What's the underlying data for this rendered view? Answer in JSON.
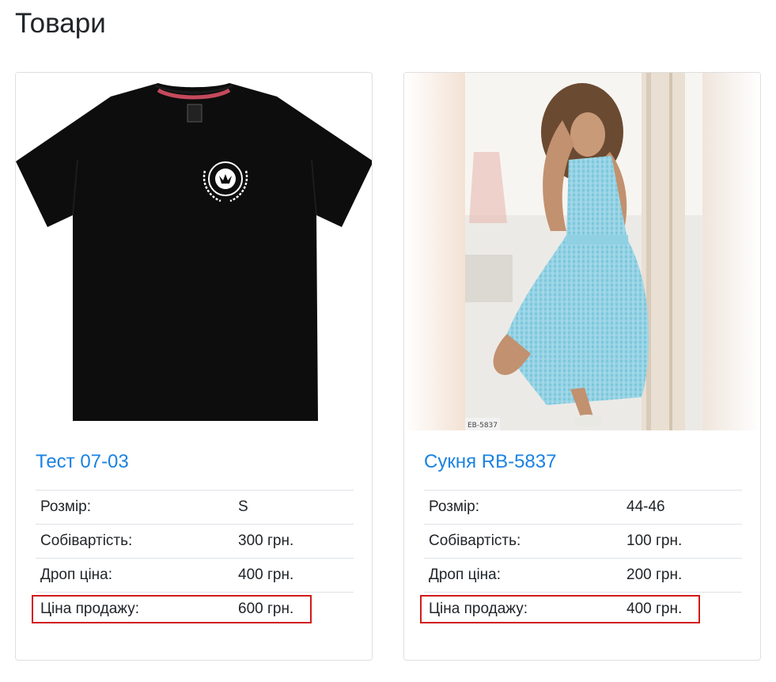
{
  "page": {
    "title": "Товари"
  },
  "products": [
    {
      "title": "Тест 07-03",
      "image": "black-tshirt",
      "rows": [
        {
          "label": "Розмір:",
          "value": "S"
        },
        {
          "label": "Собівартість:",
          "value": "300 грн."
        },
        {
          "label": "Дроп ціна:",
          "value": "400 грн."
        },
        {
          "label": "Ціна продажу:",
          "value": "600 грн."
        }
      ]
    },
    {
      "title": "Сукня RB-5837",
      "image": "blue-gingham-dress-photo",
      "image_watermark": "EB-5837",
      "rows": [
        {
          "label": "Розмір:",
          "value": "44-46"
        },
        {
          "label": "Собівартість:",
          "value": "100 грн."
        },
        {
          "label": "Дроп ціна:",
          "value": "200 грн."
        },
        {
          "label": "Ціна продажу:",
          "value": "400 грн."
        }
      ]
    }
  ],
  "colors": {
    "link": "#1a82e2",
    "highlight_border": "#d21a1a",
    "card_border": "#dfdfdf",
    "row_border": "#dee2e6"
  }
}
